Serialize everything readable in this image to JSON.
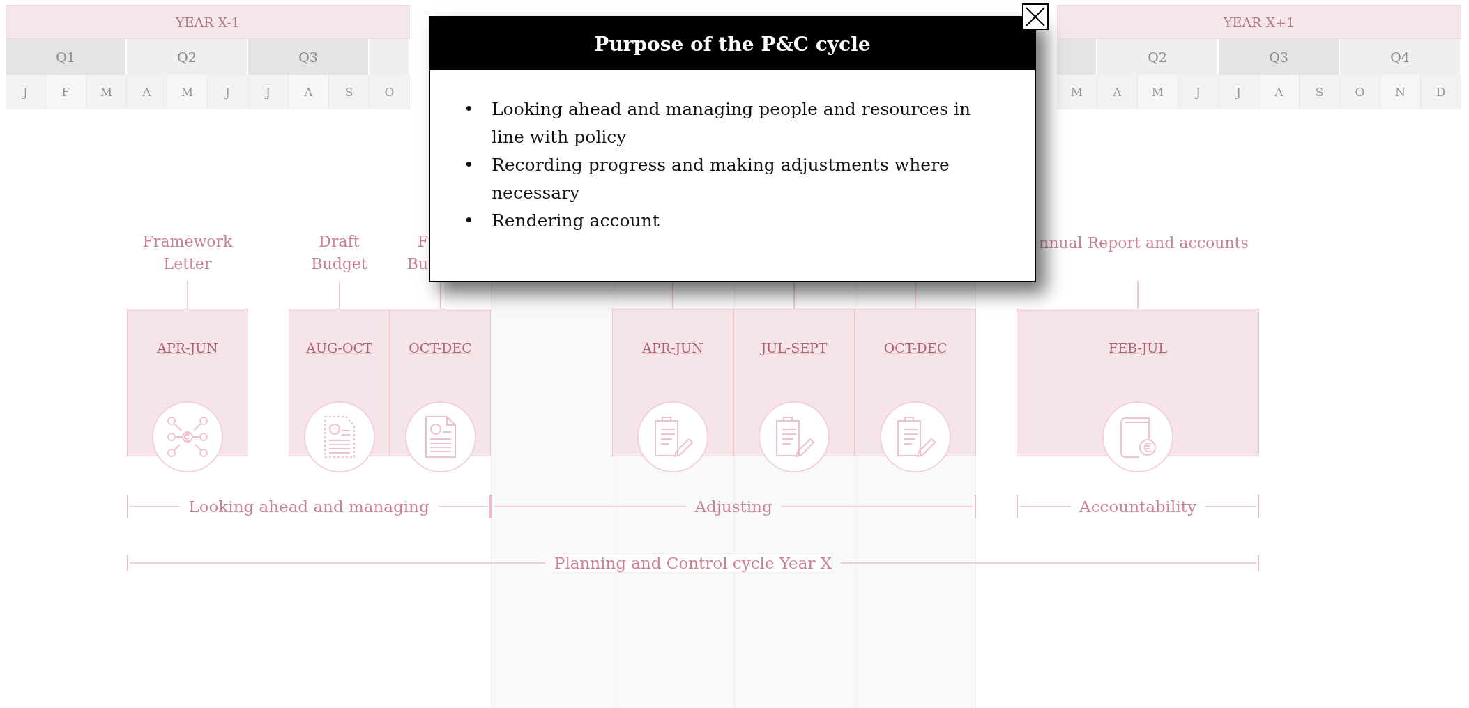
{
  "header": {
    "left": {
      "year": "YEAR X-1",
      "quarters": [
        {
          "label": "Q1",
          "months": [
            "J",
            "F",
            "M"
          ]
        },
        {
          "label": "Q2",
          "months": [
            "A",
            "M",
            "J"
          ]
        },
        {
          "label": "Q3",
          "months": [
            "J",
            "A",
            "S"
          ]
        },
        {
          "months": [
            "O"
          ]
        }
      ]
    },
    "right": {
      "year": "YEAR X+1",
      "quarters": [
        {
          "months": [
            "M"
          ]
        },
        {
          "label": "Q2",
          "months": [
            "A",
            "M",
            "J"
          ]
        },
        {
          "label": "Q3",
          "months": [
            "J",
            "A",
            "S"
          ]
        },
        {
          "label": "Q4",
          "months": [
            "O",
            "N",
            "D"
          ]
        }
      ]
    }
  },
  "stages": [
    {
      "label": "Framework Letter",
      "period": "APR-JUN",
      "kind": "network"
    },
    {
      "label": "Draft Budget",
      "period": "AUG-OCT",
      "kind": "draft"
    },
    {
      "label": "F Bu",
      "period": "OCT-DEC",
      "kind": "document"
    },
    {
      "period": "APR-JUN",
      "kind": "clipboard"
    },
    {
      "period": "JUL-SEPT",
      "kind": "clipboard"
    },
    {
      "period": "OCT-DEC",
      "kind": "clipboard"
    },
    {
      "label": "nnual Report and accounts",
      "period": "FEB-JUL",
      "kind": "book"
    }
  ],
  "phases": [
    "Looking ahead and managing",
    "Adjusting",
    "Accountability"
  ],
  "cycle": "Planning and Control cycle Year X",
  "dialog": {
    "title": "Purpose of the P&C cycle",
    "bullet": "•",
    "items": [
      "Looking ahead and managing people and resources in line with policy",
      "Recording progress and making adjustments where necessary",
      "Rendering account"
    ]
  }
}
